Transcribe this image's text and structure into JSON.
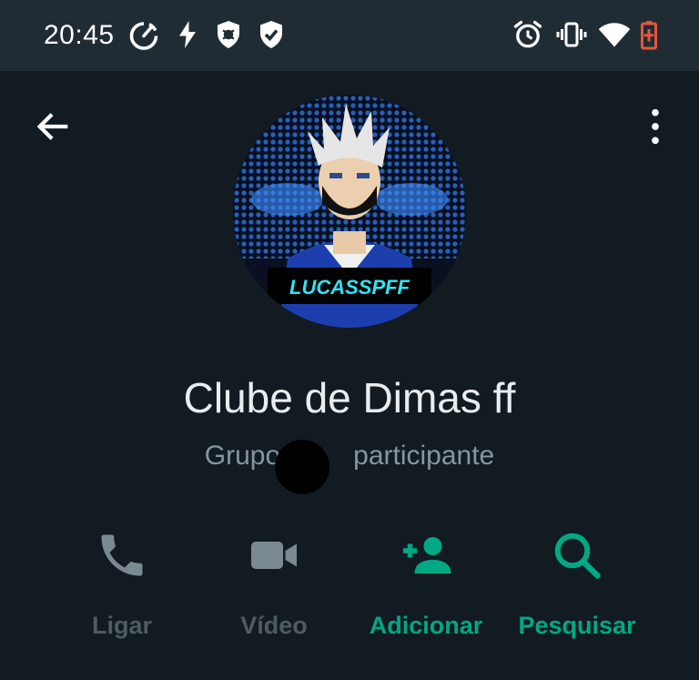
{
  "status_bar": {
    "time": "20:45",
    "left_icons": [
      "speedometer-icon",
      "flash-icon",
      "bug-shield-icon",
      "shield-check-icon"
    ],
    "right_icons": [
      "alarm-icon",
      "vibrate-icon",
      "wifi-icon",
      "battery-charging-icon"
    ],
    "battery_color": "#e8553a"
  },
  "header": {
    "back_icon": "arrow-left-icon",
    "menu_icon": "more-vert-icon"
  },
  "profile": {
    "avatar_text": "LUCASSPFF",
    "group_name": "Clube de Dimas ff",
    "subtitle_left": "Grupo",
    "subtitle_right": "participante"
  },
  "actions": [
    {
      "label": "Ligar",
      "icon": "phone-icon",
      "enabled": false
    },
    {
      "label": "Vídeo",
      "icon": "video-camera-icon",
      "enabled": false
    },
    {
      "label": "Adicionar",
      "icon": "person-add-icon",
      "enabled": true
    },
    {
      "label": "Pesquisar",
      "icon": "search-icon",
      "enabled": true
    }
  ],
  "colors": {
    "background": "#121b22",
    "status_bar": "#1f2c34",
    "accent": "#00a884",
    "disabled": "#4f5b62",
    "text_primary": "#e9edef",
    "text_secondary": "#8696a0"
  }
}
